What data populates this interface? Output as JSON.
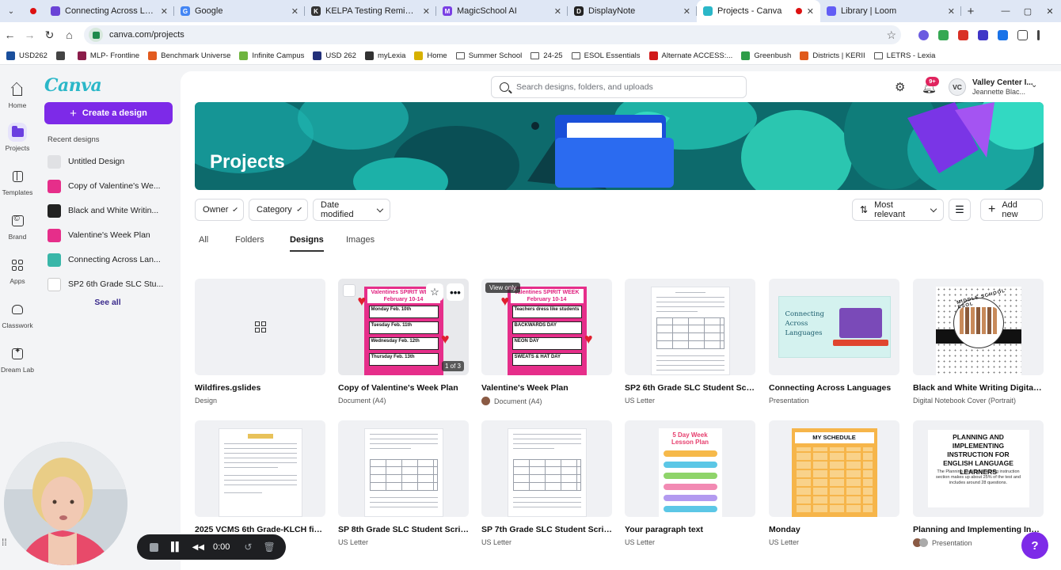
{
  "browser": {
    "tabs": [
      {
        "title": "Connecting Across Language",
        "color": "#6a43d6",
        "glyph": "",
        "active": false
      },
      {
        "title": "Google",
        "color": "#4285f4",
        "glyph": "G",
        "active": false
      },
      {
        "title": "KELPA Testing Reminder",
        "color": "#333333",
        "glyph": "K",
        "active": false
      },
      {
        "title": "MagicSchool AI",
        "color": "#7a3fe4",
        "glyph": "M",
        "active": false
      },
      {
        "title": "DisplayNote",
        "color": "#222222",
        "glyph": "D",
        "active": false
      },
      {
        "title": "Projects - Canva",
        "color": "#2bb7c8",
        "glyph": "",
        "active": true
      },
      {
        "title": "Library | Loom",
        "color": "#625df5",
        "glyph": "",
        "active": false
      }
    ],
    "url": "canva.com/projects",
    "bookmarks": [
      {
        "label": "USD262",
        "color": "#1a4f9c"
      },
      {
        "label": "",
        "color": "#444444"
      },
      {
        "label": "MLP- Frontline",
        "color": "#8b1d4a"
      },
      {
        "label": "Benchmark Universe",
        "color": "#e25b1f"
      },
      {
        "label": "Infinite Campus",
        "color": "#6fb43f"
      },
      {
        "label": "USD 262",
        "color": "#23307a"
      },
      {
        "label": "myLexia",
        "color": "#333333"
      },
      {
        "label": "Home",
        "color": "#d7b100"
      },
      {
        "label": "Summer School",
        "color": "folder"
      },
      {
        "label": "24-25",
        "color": "folder"
      },
      {
        "label": "ESOL Essentials",
        "color": "folder"
      },
      {
        "label": "Alternate ACCESS:...",
        "color": "#d11a1a"
      },
      {
        "label": "Greenbush",
        "color": "#2f9d49"
      },
      {
        "label": "Districts | KERII",
        "color": "#e05a1c"
      },
      {
        "label": "LETRS - Lexia",
        "color": "folder"
      }
    ]
  },
  "rail": [
    {
      "label": "Home",
      "icon": "home-icon"
    },
    {
      "label": "Projects",
      "icon": "folder-icon"
    },
    {
      "label": "Templates",
      "icon": "templates-icon"
    },
    {
      "label": "Brand",
      "icon": "brand-icon"
    },
    {
      "label": "Apps",
      "icon": "apps-icon"
    },
    {
      "label": "Classwork",
      "icon": "classwork-icon"
    },
    {
      "label": "Dream Lab",
      "icon": "dream-lab-icon"
    }
  ],
  "side": {
    "logo": "Canva",
    "create_label": "Create a design",
    "recent_title": "Recent designs",
    "recent": [
      {
        "label": "Untitled Design",
        "color": "#e0e1e4"
      },
      {
        "label": "Copy of Valentine's We...",
        "color": "#e62e8a"
      },
      {
        "label": "Black and White Writin...",
        "color": "#222222"
      },
      {
        "label": "Valentine's Week Plan",
        "color": "#e62e8a"
      },
      {
        "label": "Connecting Across Lan...",
        "color": "#39b6a8"
      },
      {
        "label": "SP2 6th Grade SLC Stu...",
        "color": "#ffffff"
      }
    ],
    "see_all": "See all"
  },
  "header": {
    "search_placeholder": "Search designs, folders, and uploads",
    "badge": "9+",
    "avatar": "VC",
    "account_name": "Valley Center I...",
    "account_sub": "Jeannette Blac..."
  },
  "hero": {
    "title": "Projects"
  },
  "filters": {
    "owner": "Owner",
    "category": "Category",
    "date": "Date modified",
    "sort": "Most relevant",
    "add_new": "Add new"
  },
  "tabs": [
    "All",
    "Folders",
    "Designs",
    "Images"
  ],
  "cards_row1": [
    {
      "title": "Wildfires.gslides",
      "sub": "Design"
    },
    {
      "title": "Copy of Valentine's Week Plan",
      "sub": "Document (A4)"
    },
    {
      "title": "Valentine's Week Plan",
      "sub": "Document (A4)"
    },
    {
      "title": "SP2 6th Grade SLC Student Scri...",
      "sub": "US Letter"
    },
    {
      "title": "Connecting Across Languages",
      "sub": "Presentation"
    },
    {
      "title": "Black and White Writing Digital ...",
      "sub": "Digital Notebook Cover (Portrait)"
    }
  ],
  "cards_row2": [
    {
      "title": "2025 VCMS 6th Grade-KLCH fiel...",
      "sub": ""
    },
    {
      "title": "SP 8th Grade SLC Student Scrip...",
      "sub": "US Letter"
    },
    {
      "title": "SP 7th Grade SLC Student Script...",
      "sub": "US Letter"
    },
    {
      "title": "Your paragraph text",
      "sub": "US Letter"
    },
    {
      "title": "Monday",
      "sub": "US Letter"
    },
    {
      "title": "Planning and Implementing Inst...",
      "sub": "Presentation"
    }
  ],
  "thumbs": {
    "valentine_title": "Valentines SPIRIT WEEK",
    "valentine_date": "February 10-14",
    "valentine_rows": [
      "Monday  Feb. 10th",
      "Tuesday  Feb. 11th",
      "Wednesday Feb. 12th",
      "Thursday  Feb. 13th"
    ],
    "valentine_notes": [
      "Teachers dress like students",
      "BACKWARDS DAY",
      "NEON DAY",
      "SWEATS & HAT DAY"
    ],
    "pages": "1 of 3",
    "view_only": "View only",
    "connect_text": "Connecting Across Languages",
    "bw_text": "MIDDLE SCHOOL ESOL",
    "lesson_title": "5 Day Week Lesson Plan",
    "sched_title": "MY SCHEDULE",
    "plan_title": "PLANNING AND IMPLEMENTING INSTRUCTION FOR ENGLISH LANGUAGE LEARNERS",
    "plan_body": "The Planning and Implementing instruction section makes up about 25% of the test and includes around 28 questions."
  },
  "recorder": {
    "time": "0:00"
  },
  "help": "?"
}
